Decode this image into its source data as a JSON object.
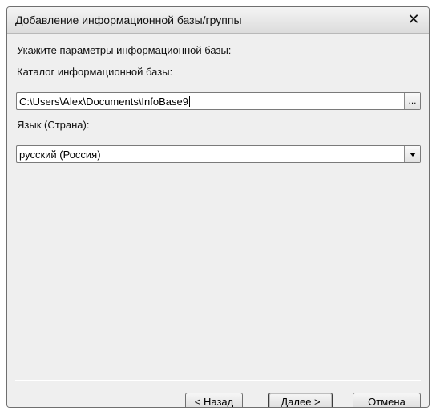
{
  "dialog": {
    "title": "Добавление информационной базы/группы",
    "close_glyph": "✕"
  },
  "form": {
    "instruction": "Укажите параметры информационной базы:",
    "catalog_label": "Каталог информационной базы:",
    "catalog_value": "C:\\Users\\Alex\\Documents\\InfoBase9",
    "browse_label": "...",
    "language_label": "Язык (Страна):",
    "language_value": "русский (Россия)"
  },
  "buttons": {
    "back": "< Назад",
    "next": "Далее >",
    "cancel": "Отмена"
  },
  "icons": {
    "close": "close-icon",
    "dropdown": "chevron-down-icon"
  }
}
